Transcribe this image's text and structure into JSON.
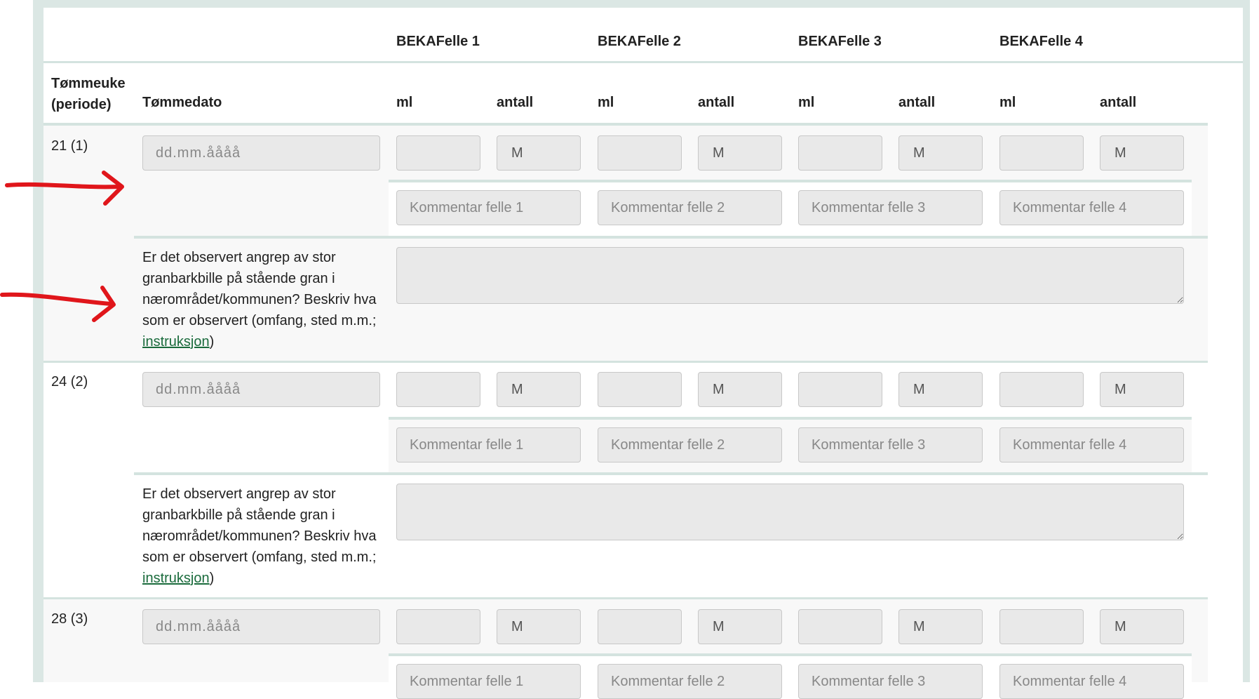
{
  "table": {
    "header": {
      "col_week": "Tømmeuke (periode)",
      "col_date": "Tømmedato",
      "traps": [
        "BEKAFelle 1",
        "BEKAFelle 2",
        "BEKAFelle 3",
        "BEKAFelle 4"
      ],
      "sub_ml": "ml",
      "sub_count": "antall"
    },
    "rows": [
      {
        "week": "21 (1)",
        "date_placeholder": "dd.mm.åååå",
        "count_value": "M",
        "comment_placeholders": [
          "Kommentar felle 1",
          "Kommentar felle 2",
          "Kommentar felle 3",
          "Kommentar felle 4"
        ],
        "question_text": "Er det observert angrep av stor granbarkbille på stående gran i nærområdet/kommunen? Beskriv hva som er observert (omfang, sted m.m.; ",
        "question_link": "instruksjon",
        "question_close": ")"
      },
      {
        "week": "24 (2)",
        "date_placeholder": "dd.mm.åååå",
        "count_value": "M",
        "comment_placeholders": [
          "Kommentar felle 1",
          "Kommentar felle 2",
          "Kommentar felle 3",
          "Kommentar felle 4"
        ],
        "question_text": "Er det observert angrep av stor granbarkbille på stående gran i nærområdet/kommunen? Beskriv hva som er observert (omfang, sted m.m.; ",
        "question_link": "instruksjon",
        "question_close": ")"
      },
      {
        "week": "28 (3)",
        "date_placeholder": "dd.mm.åååå",
        "count_value": "M",
        "comment_placeholders": [
          "Kommentar felle 1",
          "Kommentar felle 2",
          "Kommentar felle 3",
          "Kommentar felle 4"
        ]
      }
    ]
  },
  "annotations": {
    "arrow_color": "#e0161b"
  },
  "colors": {
    "frame": "#dbe7e4",
    "link": "#1a6b3c",
    "input_bg": "#e9e9e9"
  }
}
